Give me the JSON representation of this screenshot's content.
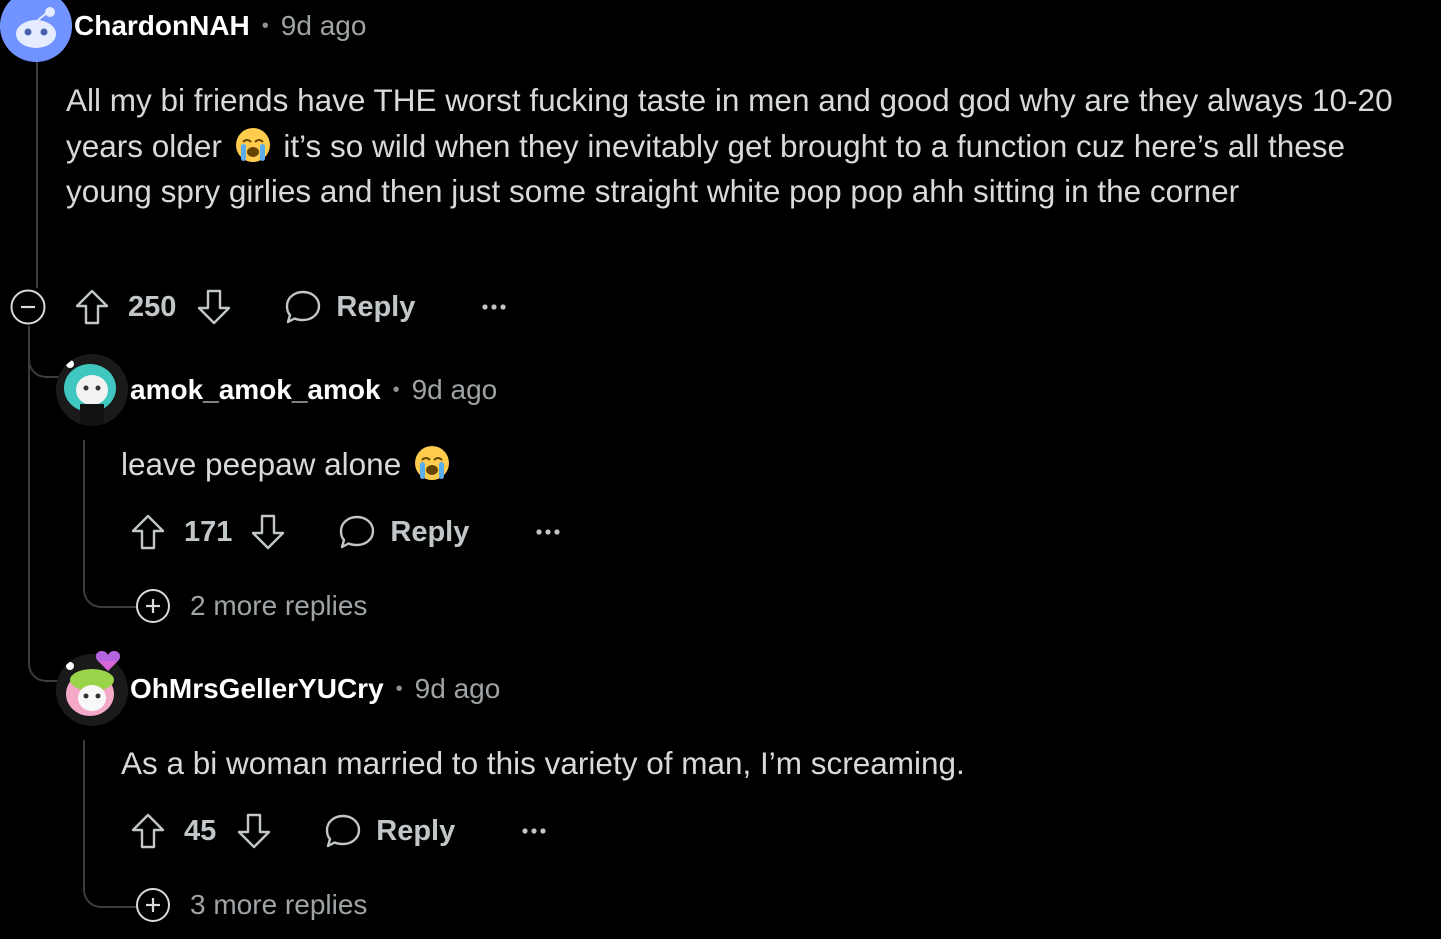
{
  "comments": [
    {
      "username": "ChardonNAH",
      "separator": "•",
      "time": "9d ago",
      "body_parts": [
        "All my bi friends have THE worst fucking taste in men and good god why are they always 10-20 years older",
        "it’s so wild when they inevitably get brought to a function cuz here’s all these young spry girlies and then just some straight white pop pop ahh sitting in the corner"
      ],
      "votes": "250",
      "reply_label": "Reply",
      "more_label": "..."
    },
    {
      "username": "amok_amok_amok",
      "separator": "•",
      "time": "9d ago",
      "body": "leave peepaw alone",
      "votes": "171",
      "reply_label": "Reply",
      "more_label": "...",
      "more_replies": "2 more replies"
    },
    {
      "username": "OhMrsGellerYUCry",
      "separator": "•",
      "time": "9d ago",
      "body": "As a bi woman married to this variety of man, I’m screaming.",
      "votes": "45",
      "reply_label": "Reply",
      "more_label": "...",
      "more_replies": "3 more replies"
    }
  ],
  "icons": {
    "collapse": "minus-circle-icon",
    "upvote": "arrow-up-icon",
    "downvote": "arrow-down-icon",
    "reply": "speech-bubble-icon",
    "overflow": "ellipsis-icon",
    "expand": "plus-circle-icon",
    "emoji": "loudly-crying-face-emoji"
  },
  "colors": {
    "background": "#000000",
    "text": "#d7dadc",
    "muted": "#9ea3a6",
    "username": "#ffffff",
    "thread_line": "#3a3d40"
  }
}
